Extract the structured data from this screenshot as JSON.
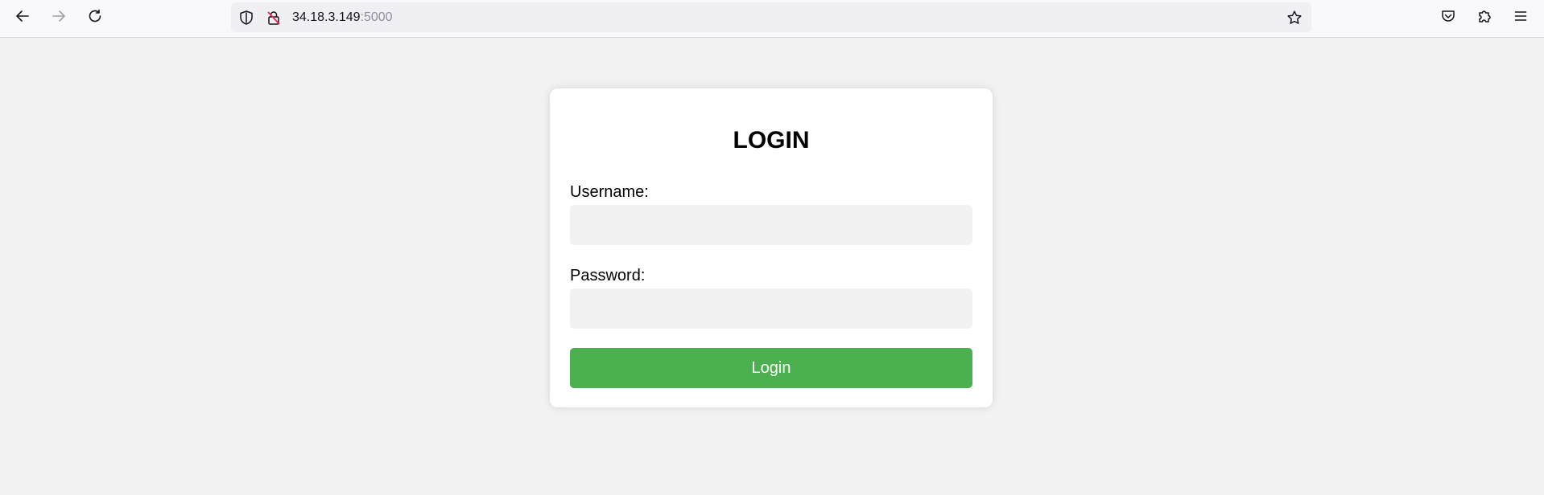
{
  "browser": {
    "url_host": "34.18.3.149",
    "url_port": ":5000",
    "icons": {
      "back": "back-arrow-icon",
      "forward": "forward-arrow-icon",
      "reload": "reload-icon",
      "shield": "shield-icon",
      "insecure": "insecure-lock-icon",
      "bookmark": "star-icon",
      "pocket": "pocket-icon",
      "extensions": "puzzle-icon",
      "menu": "hamburger-menu-icon"
    }
  },
  "login_form": {
    "title": "LOGIN",
    "username_label": "Username:",
    "username_value": "",
    "password_label": "Password:",
    "password_value": "",
    "submit_label": "Login"
  },
  "colors": {
    "page_background": "#f2f2f2",
    "card_background": "#ffffff",
    "input_background": "#f1f1f1",
    "button_background": "#4caf50",
    "button_text": "#ffffff"
  }
}
